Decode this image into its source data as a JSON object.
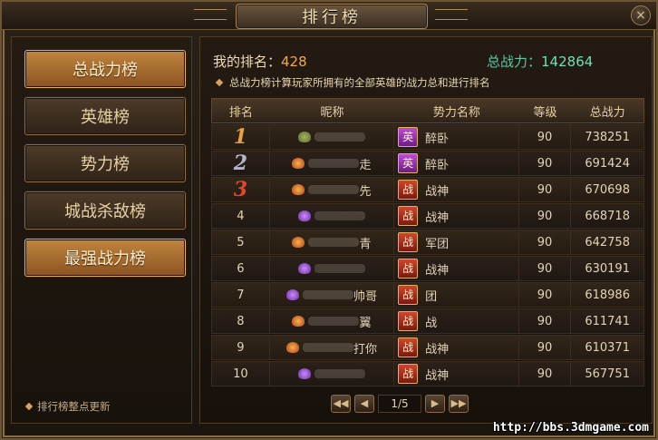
{
  "window": {
    "title": "排行榜",
    "close_icon": "×"
  },
  "sidebar": {
    "buttons": [
      {
        "label": "总战力榜",
        "active": true
      },
      {
        "label": "英雄榜",
        "active": false
      },
      {
        "label": "势力榜",
        "active": false
      },
      {
        "label": "城战杀敌榜",
        "active": false
      },
      {
        "label": "最强战力榜",
        "active": true
      }
    ],
    "note": "排行榜整点更新"
  },
  "summary": {
    "my_rank_label": "我的排名：",
    "my_rank_value": "428",
    "total_power_label": "总战力：",
    "total_power_value": "142864",
    "description": "总战力榜计算玩家所拥有的全部英雄的战力总和进行排名"
  },
  "table": {
    "headers": [
      "排名",
      "昵称",
      "势力名称",
      "等级",
      "总战力"
    ],
    "rows": [
      {
        "rank": "1",
        "nick": "",
        "guild": "醉卧",
        "guild_badge": "英",
        "level": "90",
        "power": "738251"
      },
      {
        "rank": "2",
        "nick": "走",
        "guild": "醉卧",
        "guild_badge": "英",
        "level": "90",
        "power": "691424"
      },
      {
        "rank": "3",
        "nick": "先",
        "guild": "战神",
        "guild_badge": "战",
        "level": "90",
        "power": "670698"
      },
      {
        "rank": "4",
        "nick": "",
        "guild": "战神",
        "guild_badge": "战",
        "level": "90",
        "power": "668718"
      },
      {
        "rank": "5",
        "nick": "青",
        "guild": "军团",
        "guild_badge": "战",
        "level": "90",
        "power": "642758"
      },
      {
        "rank": "6",
        "nick": "",
        "guild": "战神",
        "guild_badge": "战",
        "level": "90",
        "power": "630191"
      },
      {
        "rank": "7",
        "nick": "帅哥",
        "guild": "团",
        "guild_badge": "战",
        "level": "90",
        "power": "618986"
      },
      {
        "rank": "8",
        "nick": "翼",
        "guild": "战",
        "guild_badge": "战",
        "level": "90",
        "power": "611741"
      },
      {
        "rank": "9",
        "nick": "打你",
        "guild": "战神",
        "guild_badge": "战",
        "level": "90",
        "power": "610371"
      },
      {
        "rank": "10",
        "nick": "",
        "guild": "战神",
        "guild_badge": "战",
        "level": "90",
        "power": "567751"
      }
    ]
  },
  "pager": {
    "first": "◀◀",
    "prev": "◀",
    "page_text": "1/5",
    "next": "▶",
    "last": "▶▶"
  },
  "watermark": "http://bbs.3dmgame.com",
  "colors": {
    "accent": "#f0a94f",
    "power_value": "#6fe0b4",
    "active_button": "#c2853e"
  }
}
